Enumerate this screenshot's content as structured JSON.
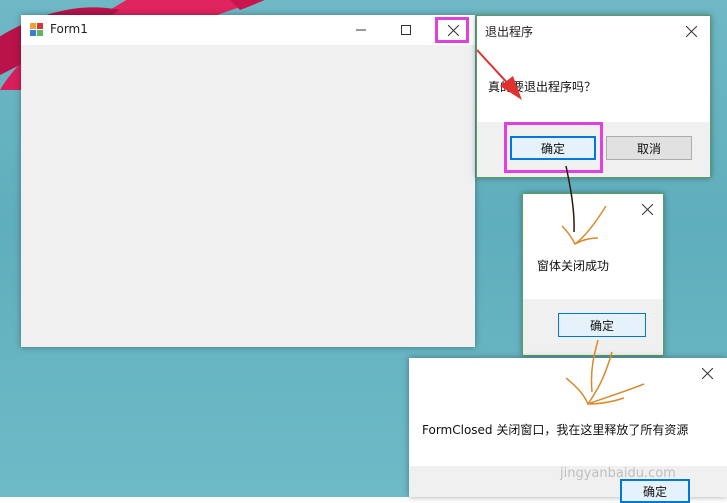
{
  "form1": {
    "title": "Form1"
  },
  "exit_dialog": {
    "title": "退出程序",
    "message": "真的要退出程序吗？",
    "ok_label": "确定",
    "cancel_label": "取消"
  },
  "closed_dialog": {
    "message": "窗体关闭成功",
    "ok_label": "确定"
  },
  "formclosed_dialog": {
    "message": "FormClosed 关闭窗口，我在这里释放了所有资源",
    "ok_label": "确定"
  },
  "watermark": "jingyanbaidu.com",
  "colors": {
    "highlight": "#e040e0",
    "arrow": "#e03030",
    "pen": "#d98a2a",
    "accent": "#0078d7"
  }
}
